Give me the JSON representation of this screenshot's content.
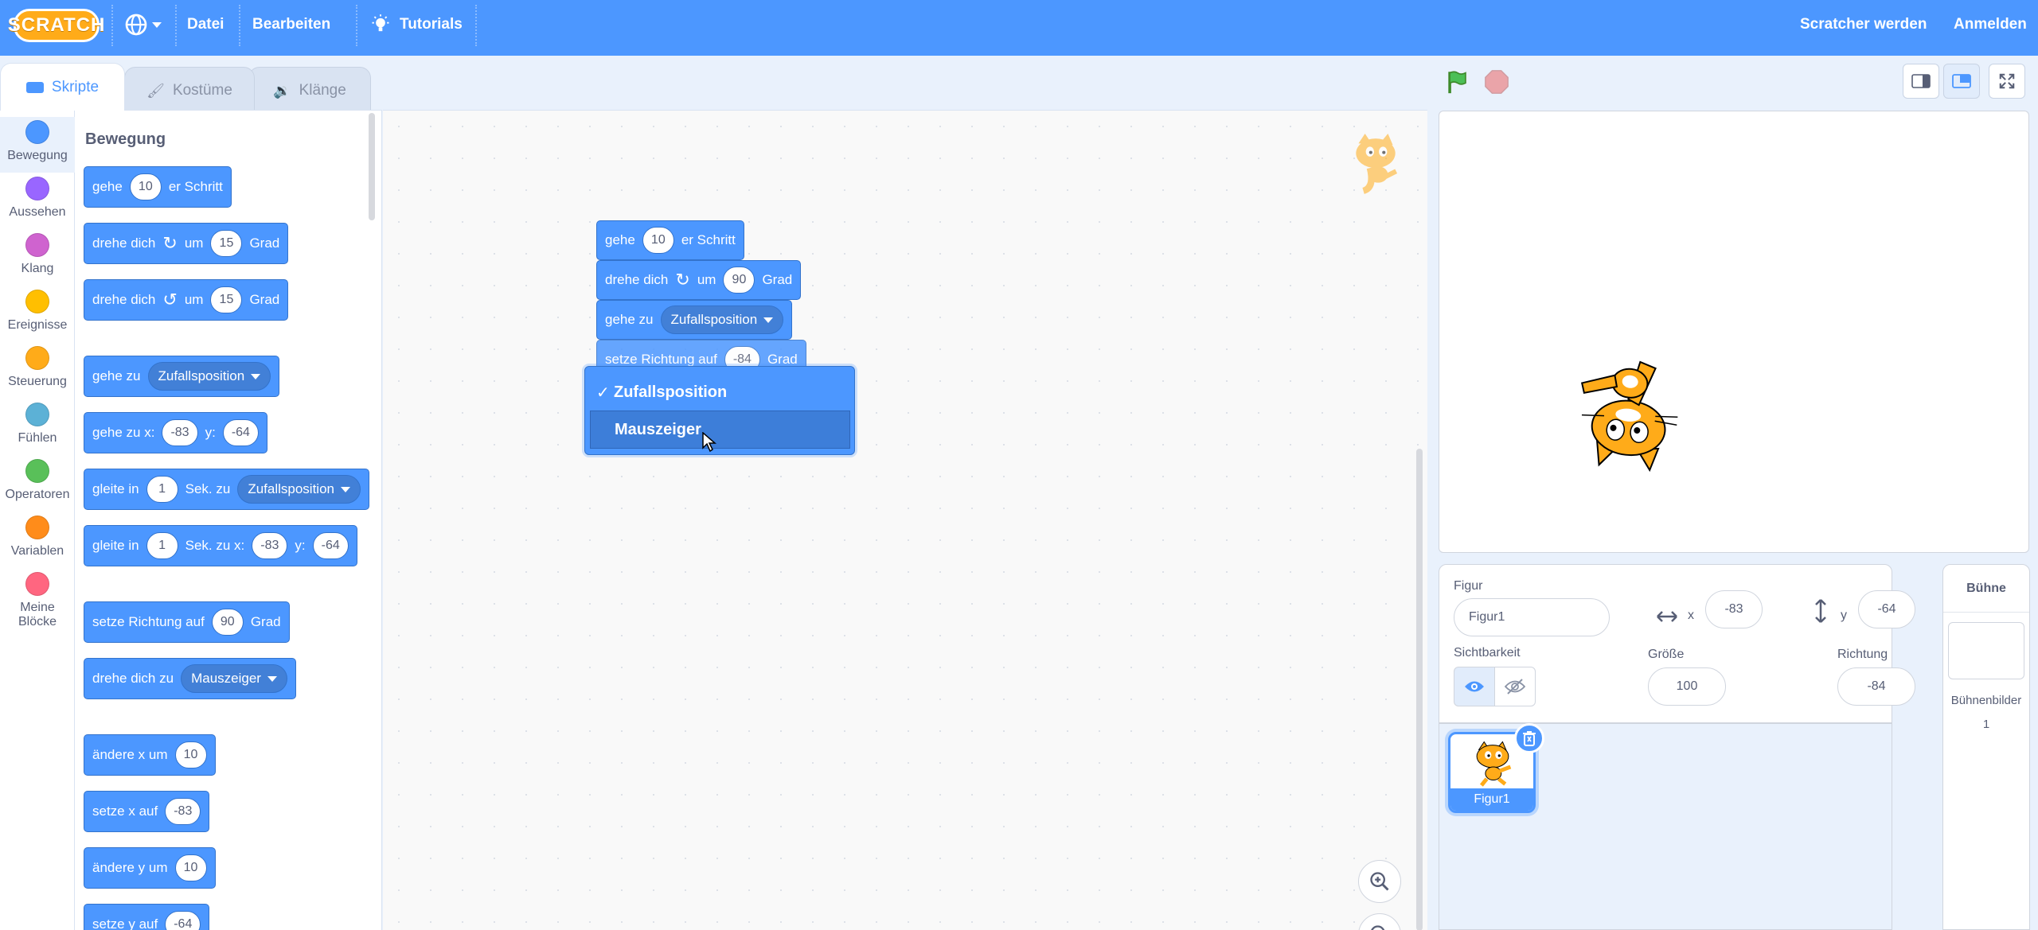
{
  "menubar": {
    "logo": "SCRATCH",
    "file": "Datei",
    "edit": "Bearbeiten",
    "tutorials": "Tutorials",
    "join": "Scratcher werden",
    "signin": "Anmelden",
    "colors": {
      "bar": "#4c97ff"
    }
  },
  "tabs": {
    "code": "Skripte",
    "costumes": "Kostüme",
    "sounds": "Klänge"
  },
  "categories": [
    {
      "label": "Bewegung",
      "color": "#4c97ff"
    },
    {
      "label": "Aussehen",
      "color": "#9966ff"
    },
    {
      "label": "Klang",
      "color": "#cf63cf"
    },
    {
      "label": "Ereignisse",
      "color": "#ffbf00"
    },
    {
      "label": "Steuerung",
      "color": "#ffab19"
    },
    {
      "label": "Fühlen",
      "color": "#5cb1d6"
    },
    {
      "label": "Operatoren",
      "color": "#59c059"
    },
    {
      "label": "Variablen",
      "color": "#ff8c1a"
    },
    {
      "label": "Meine",
      "label2": "Blöcke",
      "color": "#ff6680"
    }
  ],
  "palette": {
    "title": "Bewegung",
    "move": {
      "a": "gehe",
      "n": "10",
      "b": "er Schritt"
    },
    "turn_right": {
      "a": "drehe dich",
      "b": "um",
      "n": "15",
      "c": "Grad"
    },
    "turn_left": {
      "a": "drehe dich",
      "b": "um",
      "n": "15",
      "c": "Grad"
    },
    "goto": {
      "a": "gehe zu",
      "opt": "Zufallsposition"
    },
    "goto_xy": {
      "a": "gehe zu x:",
      "x": "-83",
      "b": "y:",
      "y": "-64"
    },
    "glide": {
      "a": "gleite in",
      "n": "1",
      "b": "Sek. zu",
      "opt": "Zufallsposition"
    },
    "glide_xy": {
      "a": "gleite in",
      "n": "1",
      "b": "Sek. zu x:",
      "x": "-83",
      "c": "y:",
      "y": "-64"
    },
    "point_dir": {
      "a": "setze Richtung auf",
      "n": "90",
      "b": "Grad"
    },
    "point_towards": {
      "a": "drehe dich zu",
      "opt": "Mauszeiger"
    },
    "change_x": {
      "a": "ändere x um",
      "n": "10"
    },
    "set_x": {
      "a": "setze x auf",
      "n": "-83"
    },
    "change_y": {
      "a": "ändere y um",
      "n": "10"
    },
    "set_y": {
      "a": "setze y auf",
      "n": "-64"
    }
  },
  "script": {
    "move": {
      "a": "gehe",
      "n": "10",
      "b": "er Schritt"
    },
    "turn": {
      "a": "drehe dich",
      "b": "um",
      "n": "90",
      "c": "Grad"
    },
    "goto": {
      "a": "gehe zu",
      "opt": "Zufallsposition"
    },
    "point": {
      "a": "setze Richtung auf",
      "n": "-84",
      "b": "Grad"
    }
  },
  "dropdown": {
    "options": [
      {
        "label": "Zufallsposition",
        "checked": true
      },
      {
        "label": "Mauszeiger",
        "checked": false
      }
    ]
  },
  "sprite_info": {
    "sprite_label": "Figur",
    "sprite_name": "Figur1",
    "x_label": "x",
    "x": "-83",
    "y_label": "y",
    "y": "-64",
    "visibility_label": "Sichtbarkeit",
    "size_label": "Größe",
    "size": "100",
    "direction_label": "Richtung",
    "direction": "-84"
  },
  "sprites": [
    {
      "name": "Figur1"
    }
  ],
  "stage_pane": {
    "title": "Bühne",
    "backdrops_label": "Bühnenbilder",
    "backdrops_count": "1"
  }
}
